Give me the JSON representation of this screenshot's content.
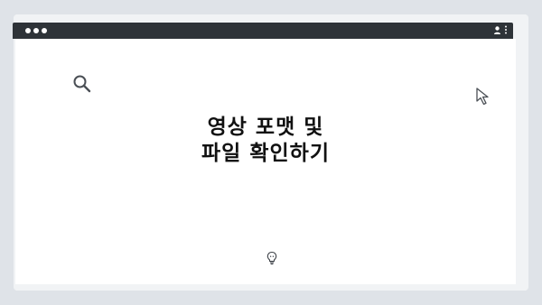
{
  "window": {
    "title_line_1": "영상 포맷 및",
    "title_line_2": "파일 확인하기"
  },
  "icons": {
    "search": "search-icon",
    "cursor": "cursor-icon",
    "bulb": "lightbulb-icon",
    "user": "user-icon",
    "menu": "kebab-menu-icon"
  },
  "colors": {
    "titlebar": "#2e3338",
    "background": "#dfe3e8",
    "card": "#f1f3f5",
    "window": "#ffffff",
    "text": "#111111"
  }
}
